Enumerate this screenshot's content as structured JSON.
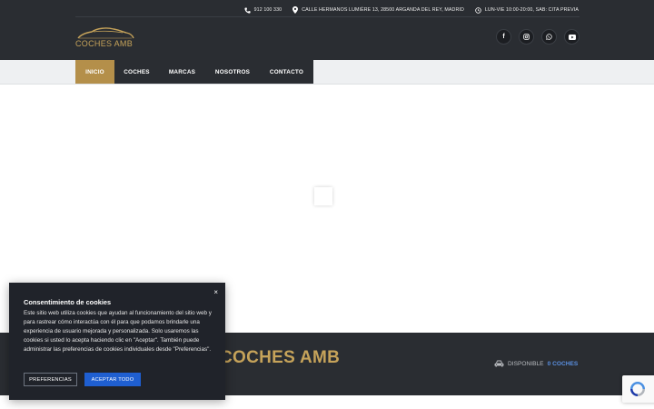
{
  "header": {
    "phone": "912 100 330",
    "address": "CALLE HERMANOS LUMIÈRE 13, 28500 ARGANDA DEL REY, MADRID",
    "hours": "LUN-VIE 10:00-20:00, SAB: CITA PREVIA",
    "logo_text": "COCHES AMB",
    "social": {
      "facebook": "f",
      "instagram": "instagram-icon",
      "whatsapp": "whatsapp-icon",
      "youtube": "youtube-icon"
    }
  },
  "nav": {
    "items": [
      {
        "label": "INICIO",
        "active": true
      },
      {
        "label": "COCHES"
      },
      {
        "label": "MARCAS"
      },
      {
        "label": "NOSOTROS"
      },
      {
        "label": "CONTACTO"
      }
    ]
  },
  "band": {
    "title": "COCHES AMB",
    "available_label": "DISPONIBLE",
    "available_count": "0 COCHES"
  },
  "cookie": {
    "title": "Consentimiento de cookies",
    "text": "Este sitio web utiliza cookies que ayudan al funcionamiento del sitio web y para rastrear cómo interactúa con él para que podamos brindarle una experiencia de usuario mejorada y personalizada. Solo usaremos las cookies si usted lo acepta haciendo clic en \"Aceptar\". También puede administrar las preferencias de cookies individuales desde \"Preferencias\".",
    "close": "×",
    "preferences_label": "PREFERENCIAS",
    "accept_label": "ACEPTAR TODO"
  },
  "colors": {
    "header_bg": "#2a2d32",
    "gold": "#c6a35a",
    "accent_blue": "#1f5fd1"
  }
}
